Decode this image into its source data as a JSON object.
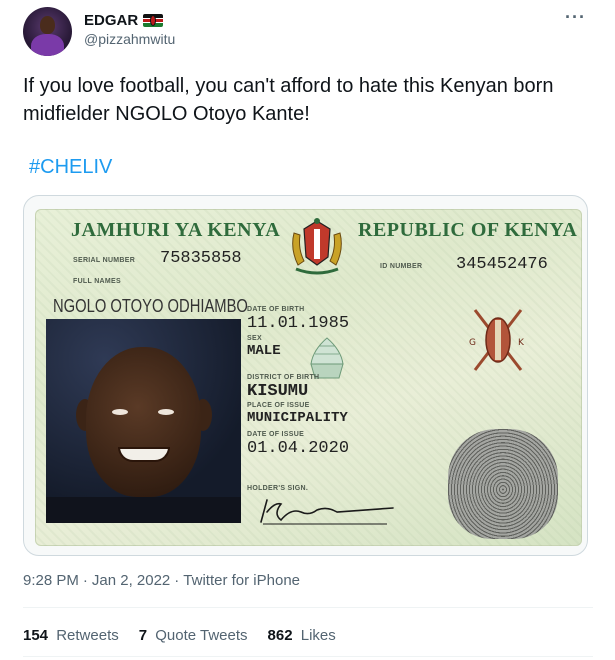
{
  "author": {
    "name": "EDGAR",
    "handle": "@pizzahmwitu",
    "flag_icon": "kenya-flag-icon"
  },
  "tweet": {
    "text": "If you love football, you can't afford to hate this Kenyan born midfielder NGOLO Otoyo Kante!",
    "hashtag": "#CHELIV"
  },
  "id_card": {
    "header_left": "JAMHURI YA KENYA",
    "header_right": "REPUBLIC OF KENYA",
    "serial_label": "SERIAL NUMBER",
    "serial_number": "75835858",
    "id_label": "ID NUMBER",
    "id_number": "345452476",
    "full_names_label": "FULL NAMES",
    "full_names": "NGOLO OTOYO ODHIAMBO",
    "dob_label": "DATE OF BIRTH",
    "dob": "11.01.1985",
    "sex_label": "SEX",
    "sex": "MALE",
    "district_label": "DISTRICT OF BIRTH",
    "district": "KISUMU",
    "place_label": "PLACE OF ISSUE",
    "place": "MUNICIPALITY",
    "issue_label": "DATE OF ISSUE",
    "issue_date": "01.04.2020",
    "sign_label": "HOLDER'S SIGN."
  },
  "meta": {
    "time": "9:28 PM",
    "sep1": "·",
    "date": "Jan 2, 2022",
    "sep2": "·",
    "source": "Twitter for iPhone"
  },
  "stats": {
    "retweets_count": "154",
    "retweets_label": "Retweets",
    "quotes_count": "7",
    "quotes_label": "Quote Tweets",
    "likes_count": "862",
    "likes_label": "Likes"
  },
  "more_label": "···",
  "colors": {
    "link": "#1d9bf0",
    "secondary_text": "#536471",
    "card_green": "#2f6b3c"
  }
}
